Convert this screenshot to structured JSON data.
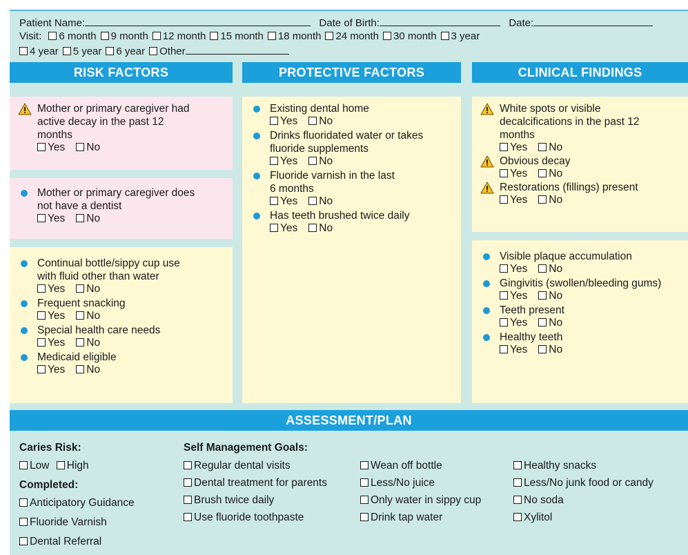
{
  "header": {
    "patient_name_label": "Patient Name:",
    "dob_label": "Date of Birth:",
    "date_label": "Date:",
    "visit_label": "Visit:",
    "visit_options_row1": [
      "6 month",
      "9 month",
      "12 month",
      "15 month",
      "18 month",
      "24 month",
      "30 month",
      "3 year"
    ],
    "visit_options_row2": [
      "4 year",
      "5 year",
      "6 year",
      "Other"
    ]
  },
  "yes_label": "Yes",
  "no_label": "No",
  "risk": {
    "title": "RISK FACTORS",
    "box1": [
      {
        "icon": "warning",
        "text": [
          "Mother or primary caregiver had",
          "active decay in the past 12",
          "months"
        ]
      }
    ],
    "box2": [
      {
        "icon": "bullet",
        "text": [
          "Mother or primary caregiver does",
          "not have a dentist"
        ]
      }
    ],
    "box3": [
      {
        "icon": "bullet",
        "text": [
          "Continual bottle/sippy cup use",
          "with fluid other than water"
        ]
      },
      {
        "icon": "bullet",
        "text": [
          "Frequent snacking"
        ]
      },
      {
        "icon": "bullet",
        "text": [
          "Special health care needs"
        ]
      },
      {
        "icon": "bullet",
        "text": [
          "Medicaid eligible"
        ]
      }
    ]
  },
  "protective": {
    "title": "PROTECTIVE FACTORS",
    "box1": [
      {
        "icon": "bullet",
        "text": [
          "Existing dental home"
        ]
      },
      {
        "icon": "bullet",
        "text": [
          "Drinks fluoridated water or takes",
          "fluoride supplements"
        ]
      },
      {
        "icon": "bullet",
        "text": [
          "Fluoride varnish in the last",
          "6 months"
        ]
      },
      {
        "icon": "bullet",
        "text": [
          "Has teeth brushed twice daily"
        ]
      }
    ]
  },
  "clinical": {
    "title": "CLINICAL FINDINGS",
    "box1": [
      {
        "icon": "warning",
        "text": [
          "White spots or visible",
          "decalcifications in the past 12",
          "months"
        ]
      },
      {
        "icon": "warning",
        "text": [
          "Obvious decay"
        ]
      },
      {
        "icon": "warning",
        "text": [
          "Restorations (fillings) present"
        ]
      }
    ],
    "box2": [
      {
        "icon": "bullet",
        "text": [
          "Visible plaque accumulation"
        ]
      },
      {
        "icon": "bullet",
        "text": [
          "Gingivitis (swollen/bleeding gums)"
        ]
      },
      {
        "icon": "bullet",
        "text": [
          "Teeth present"
        ]
      },
      {
        "icon": "bullet",
        "text": [
          "Healthy teeth"
        ]
      }
    ]
  },
  "assessment": {
    "title": "ASSESSMENT/PLAN",
    "caries_risk_label": "Caries Risk:",
    "caries_options": [
      "Low",
      "High"
    ],
    "completed_label": "Completed:",
    "completed_options": [
      "Anticipatory Guidance",
      "Fluoride Varnish",
      "Dental Referral"
    ],
    "goals_label": "Self Management Goals:",
    "goals_col1": [
      "Regular dental visits",
      "Dental treatment for parents",
      "Brush twice daily",
      "Use fluoride toothpaste"
    ],
    "goals_col2": [
      "Wean off bottle",
      "Less/No juice",
      "Only water in sippy cup",
      "Drink tap water"
    ],
    "goals_col3": [
      "Healthy snacks",
      "Less/No junk food or candy",
      "No soda",
      "Xylitol"
    ]
  },
  "colors": {
    "background": "#cce9e6",
    "header_blue": "#1ba0dc",
    "risk_pink": "#fce6ee",
    "panel_yellow": "#fef9d3",
    "bullet_blue": "#1b9ad6",
    "warning_yellow": "#f7c22a"
  }
}
